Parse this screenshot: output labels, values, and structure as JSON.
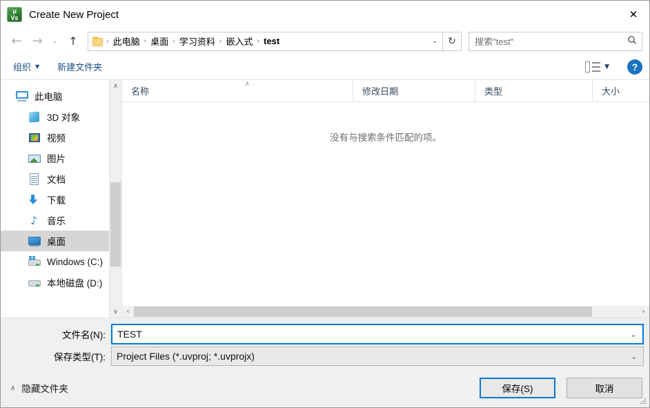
{
  "window": {
    "title": "Create New Project",
    "app_icon": "uvision-icon",
    "close_label": "✕",
    "icon_top_text": "μ",
    "icon_bottom_text": "Vs"
  },
  "nav": {
    "back_label": "←",
    "forward_label": "→",
    "history_label": "⌄",
    "up_label": "↑",
    "refresh_label": "↻",
    "dropdown_label": "⌄",
    "breadcrumbs": [
      {
        "label": "此电脑"
      },
      {
        "label": "桌面"
      },
      {
        "label": "学习资料"
      },
      {
        "label": "嵌入式"
      },
      {
        "label": "test"
      }
    ],
    "separator": "›"
  },
  "search": {
    "placeholder": "搜索\"test\"",
    "icon": "search-icon"
  },
  "toolbar": {
    "organize_label": "组织",
    "organize_caret": "▼",
    "new_folder_label": "新建文件夹",
    "view_caret": "▼",
    "help_label": "?"
  },
  "sidebar": {
    "items": [
      {
        "label": "此电脑",
        "icon": "computer-icon",
        "level": 0,
        "selected": false
      },
      {
        "label": "3D 对象",
        "icon": "3d-objects-icon",
        "level": 1,
        "selected": false
      },
      {
        "label": "视频",
        "icon": "videos-icon",
        "level": 1,
        "selected": false
      },
      {
        "label": "图片",
        "icon": "pictures-icon",
        "level": 1,
        "selected": false
      },
      {
        "label": "文档",
        "icon": "documents-icon",
        "level": 1,
        "selected": false
      },
      {
        "label": "下载",
        "icon": "downloads-icon",
        "level": 1,
        "selected": false
      },
      {
        "label": "音乐",
        "icon": "music-icon",
        "level": 1,
        "selected": false
      },
      {
        "label": "桌面",
        "icon": "desktop-icon",
        "level": 1,
        "selected": true
      },
      {
        "label": "Windows (C:)",
        "icon": "windows-drive-icon",
        "level": 1,
        "selected": false
      },
      {
        "label": "本地磁盘 (D:)",
        "icon": "local-drive-icon",
        "level": 1,
        "selected": false
      }
    ],
    "scroll_up": "∧",
    "scroll_down": "∨"
  },
  "filelist": {
    "columns": [
      {
        "label": "名称"
      },
      {
        "label": "修改日期"
      },
      {
        "label": "类型"
      },
      {
        "label": "大小"
      }
    ],
    "sort_caret": "∧",
    "empty_message": "没有与搜索条件匹配的项。",
    "rows": [],
    "hscroll_left": "‹",
    "hscroll_right": "›"
  },
  "form": {
    "filename_label": "文件名(N):",
    "filename_value": "TEST",
    "filetype_label": "保存类型(T):",
    "filetype_value": "Project Files (*.uvproj; *.uvprojx)",
    "chevron": "⌄"
  },
  "footer": {
    "hide_folders_caret": "∧",
    "hide_folders_label": "隐藏文件夹",
    "save_label": "保存(S)",
    "cancel_label": "取消"
  },
  "colors": {
    "accent": "#0078d7",
    "link": "#1b4f8a",
    "selection": "#d6d6d6",
    "chrome": "#f0f0f0",
    "help_blue": "#1b72c0"
  }
}
